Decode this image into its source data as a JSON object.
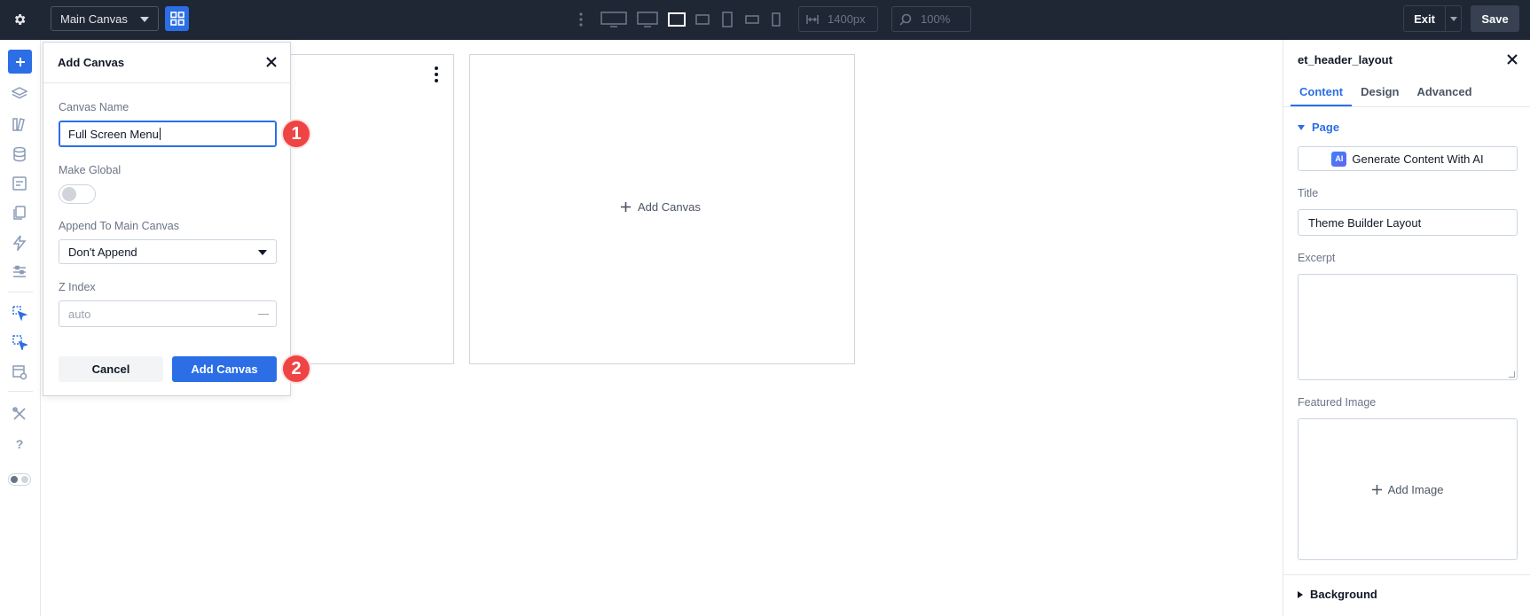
{
  "topbar": {
    "canvas_select_value": "Main Canvas",
    "width_value": "1400px",
    "zoom_value": "100%",
    "exit_label": "Exit",
    "save_label": "Save"
  },
  "main_canvas": {
    "add_canvas_label": "Add Canvas"
  },
  "add_canvas_panel": {
    "title": "Add Canvas",
    "canvas_name_label": "Canvas Name",
    "canvas_name_value": "Full Screen Menu",
    "make_global_label": "Make Global",
    "make_global_on": false,
    "append_label": "Append To Main Canvas",
    "append_value": "Don't Append",
    "z_index_label": "Z Index",
    "z_index_placeholder": "auto",
    "cancel_label": "Cancel",
    "submit_label": "Add Canvas",
    "step_badges": [
      "1",
      "2"
    ]
  },
  "settings_panel": {
    "title": "et_header_layout",
    "tabs": [
      {
        "label": "Content",
        "active": true
      },
      {
        "label": "Design",
        "active": false
      },
      {
        "label": "Advanced",
        "active": false
      }
    ],
    "page_section_label": "Page",
    "ai_icon_text": "AI",
    "ai_button_label": "Generate Content With AI",
    "title_label": "Title",
    "title_value": "Theme Builder Layout",
    "excerpt_label": "Excerpt",
    "featured_image_label": "Featured Image",
    "add_image_label": "Add Image",
    "background_section_label": "Background"
  },
  "colors": {
    "topbar_bg": "#1f2735",
    "accent": "#2b6ee6",
    "badge": "#ef4444"
  }
}
